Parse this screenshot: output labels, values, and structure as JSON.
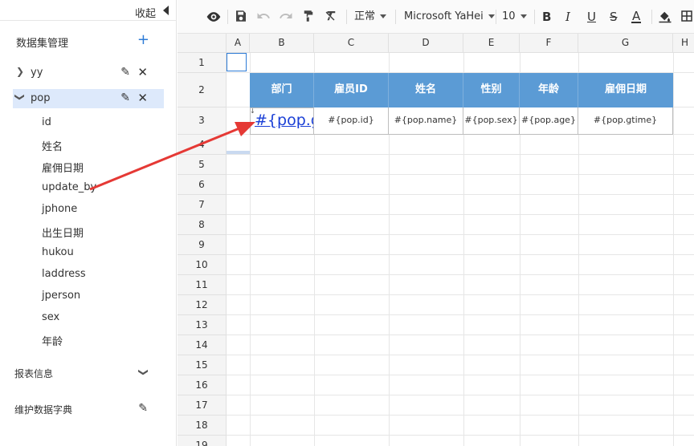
{
  "sidebar": {
    "collapse_label": "收起",
    "dataset_title": "数据集管理",
    "add_symbol": "+",
    "datasets": [
      {
        "name": "yy",
        "expanded": false
      },
      {
        "name": "pop",
        "expanded": true
      }
    ],
    "pop_fields": [
      "id",
      "姓名",
      "雇佣日期",
      "update_by",
      "jphone",
      "出生日期",
      "hukou",
      "laddress",
      "jperson",
      "sex",
      "年龄"
    ],
    "report_info": "报表信息",
    "dictionary": "维护数据字典"
  },
  "toolbar": {
    "style_select": "正常",
    "font_select": "Microsoft YaHei",
    "size_select": "10",
    "bold": "B",
    "italic": "I",
    "underline": "U",
    "strike": "S",
    "font_color": "A"
  },
  "sheet": {
    "columns": [
      "A",
      "B",
      "C",
      "D",
      "E",
      "F",
      "G",
      "H"
    ],
    "rows": [
      "1",
      "2",
      "3",
      "4",
      "5",
      "6",
      "7",
      "8",
      "9",
      "10",
      "11",
      "12",
      "13",
      "14",
      "15",
      "16",
      "17",
      "18",
      "19"
    ],
    "header_cells": [
      "部门",
      "雇员ID",
      "姓名",
      "性别",
      "年龄",
      "雇佣日期"
    ],
    "data_cells": [
      "#{pop.g",
      "#{pop.id}",
      "#{pop.name}",
      "#{pop.sex}",
      "#{pop.age}",
      "#{pop.gtime}"
    ]
  },
  "colors": {
    "header_fill": "#5b9bd5",
    "accent": "#2d7bd6",
    "arrow": "#e53935",
    "link_text": "#1a3fd6"
  },
  "icons": {
    "preview": "eye-icon",
    "save": "save-icon",
    "undo": "undo-icon",
    "redo": "redo-icon",
    "format_painter": "paint-roller-icon",
    "clear_format": "clear-format-icon",
    "fill_color": "paint-bucket-icon",
    "borders": "border-grid-icon",
    "edit": "pencil-icon",
    "close": "close-icon",
    "chevron": "chevron-icon"
  }
}
